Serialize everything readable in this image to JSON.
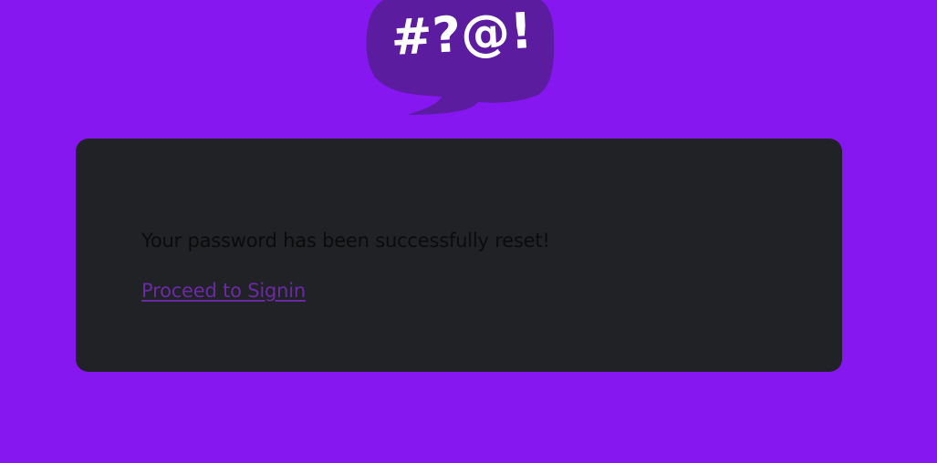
{
  "logo": {
    "text": "#?@!",
    "icon": "speech-bubble-icon",
    "bubble_color": "#5c1c9f",
    "text_color": "#ffffff"
  },
  "card": {
    "message": "Your password has been successfully reset!",
    "link_label": "Proceed to Signin"
  },
  "colors": {
    "page_background": "#8717f1",
    "card_background": "#212226",
    "message_text": "#0b0b0c",
    "link": "#6a2aa6"
  }
}
